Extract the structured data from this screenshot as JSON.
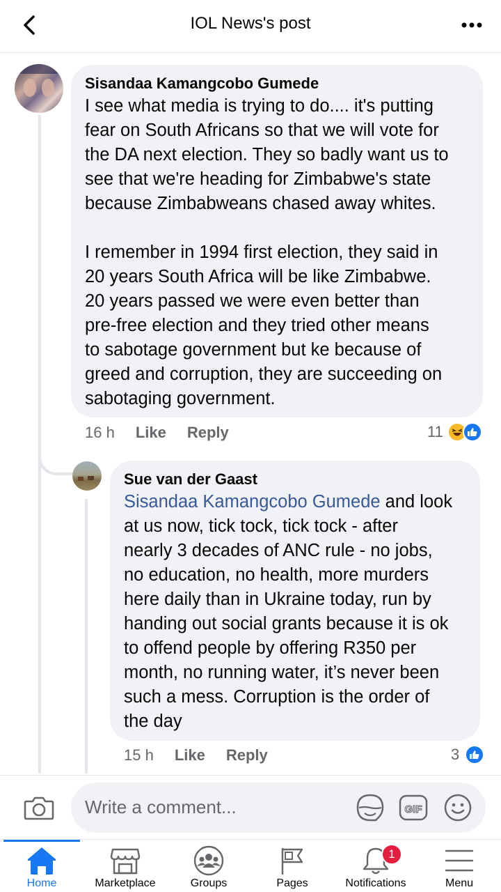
{
  "header": {
    "title": "IOL News's post",
    "back_icon": "chevron-left-icon",
    "more_icon": "more-horizontal-icon"
  },
  "comments": [
    {
      "author": "Sisandaa Kamangcobo Gumede",
      "lines": [
        "I see what media is trying to do.... it's putting",
        "fear on South Africans so that we will vote for",
        "the DA next election. They so badly want us to",
        "see that we're heading for Zimbabwe's state",
        "because Zimbabweans chased away whites.",
        "",
        "I remember in 1994 first election, they said in",
        "20 years South Africa will be like Zimbabwe.",
        "20 years passed we were even better than",
        "pre-free election and they tried other means",
        "to sabotage government but ke because of",
        "greed and corruption, they are succeeding on",
        "sabotaging government."
      ],
      "time": "16 h",
      "like_label": "Like",
      "reply_label": "Reply",
      "reaction_count": "11"
    },
    {
      "author": "Sue van der Gaast",
      "mention": "Sisandaa Kamangcobo Gumede",
      "first_line_rest": " and look",
      "lines": [
        "at us now, tick tock, tick tock - after",
        "nearly 3 decades of ANC rule - no jobs,",
        "no education, no health, more murders",
        "here daily than in Ukraine today, run by",
        "handing out social grants because it is ok",
        "to offend people by offering R350 per",
        "month, no running water, it’s never been",
        "such a mess. Corruption is the order of",
        "the day"
      ],
      "time": "15 h",
      "like_label": "Like",
      "reply_label": "Reply",
      "reaction_count": "3"
    }
  ],
  "composer": {
    "placeholder": "Write a comment..."
  },
  "tabs": [
    {
      "label": "Home",
      "icon": "home-icon",
      "active": true
    },
    {
      "label": "Marketplace",
      "icon": "marketplace-icon"
    },
    {
      "label": "Groups",
      "icon": "groups-icon"
    },
    {
      "label": "Pages",
      "icon": "pages-flag-icon"
    },
    {
      "label": "Notifications",
      "icon": "bell-icon",
      "badge": "1"
    },
    {
      "label": "Menu",
      "icon": "menu-icon"
    }
  ],
  "colors": {
    "accent": "#1877f2",
    "bubble": "#f0f2f5",
    "mention": "#385898",
    "badge": "#e41e3f",
    "secondary_text": "#65676b"
  }
}
